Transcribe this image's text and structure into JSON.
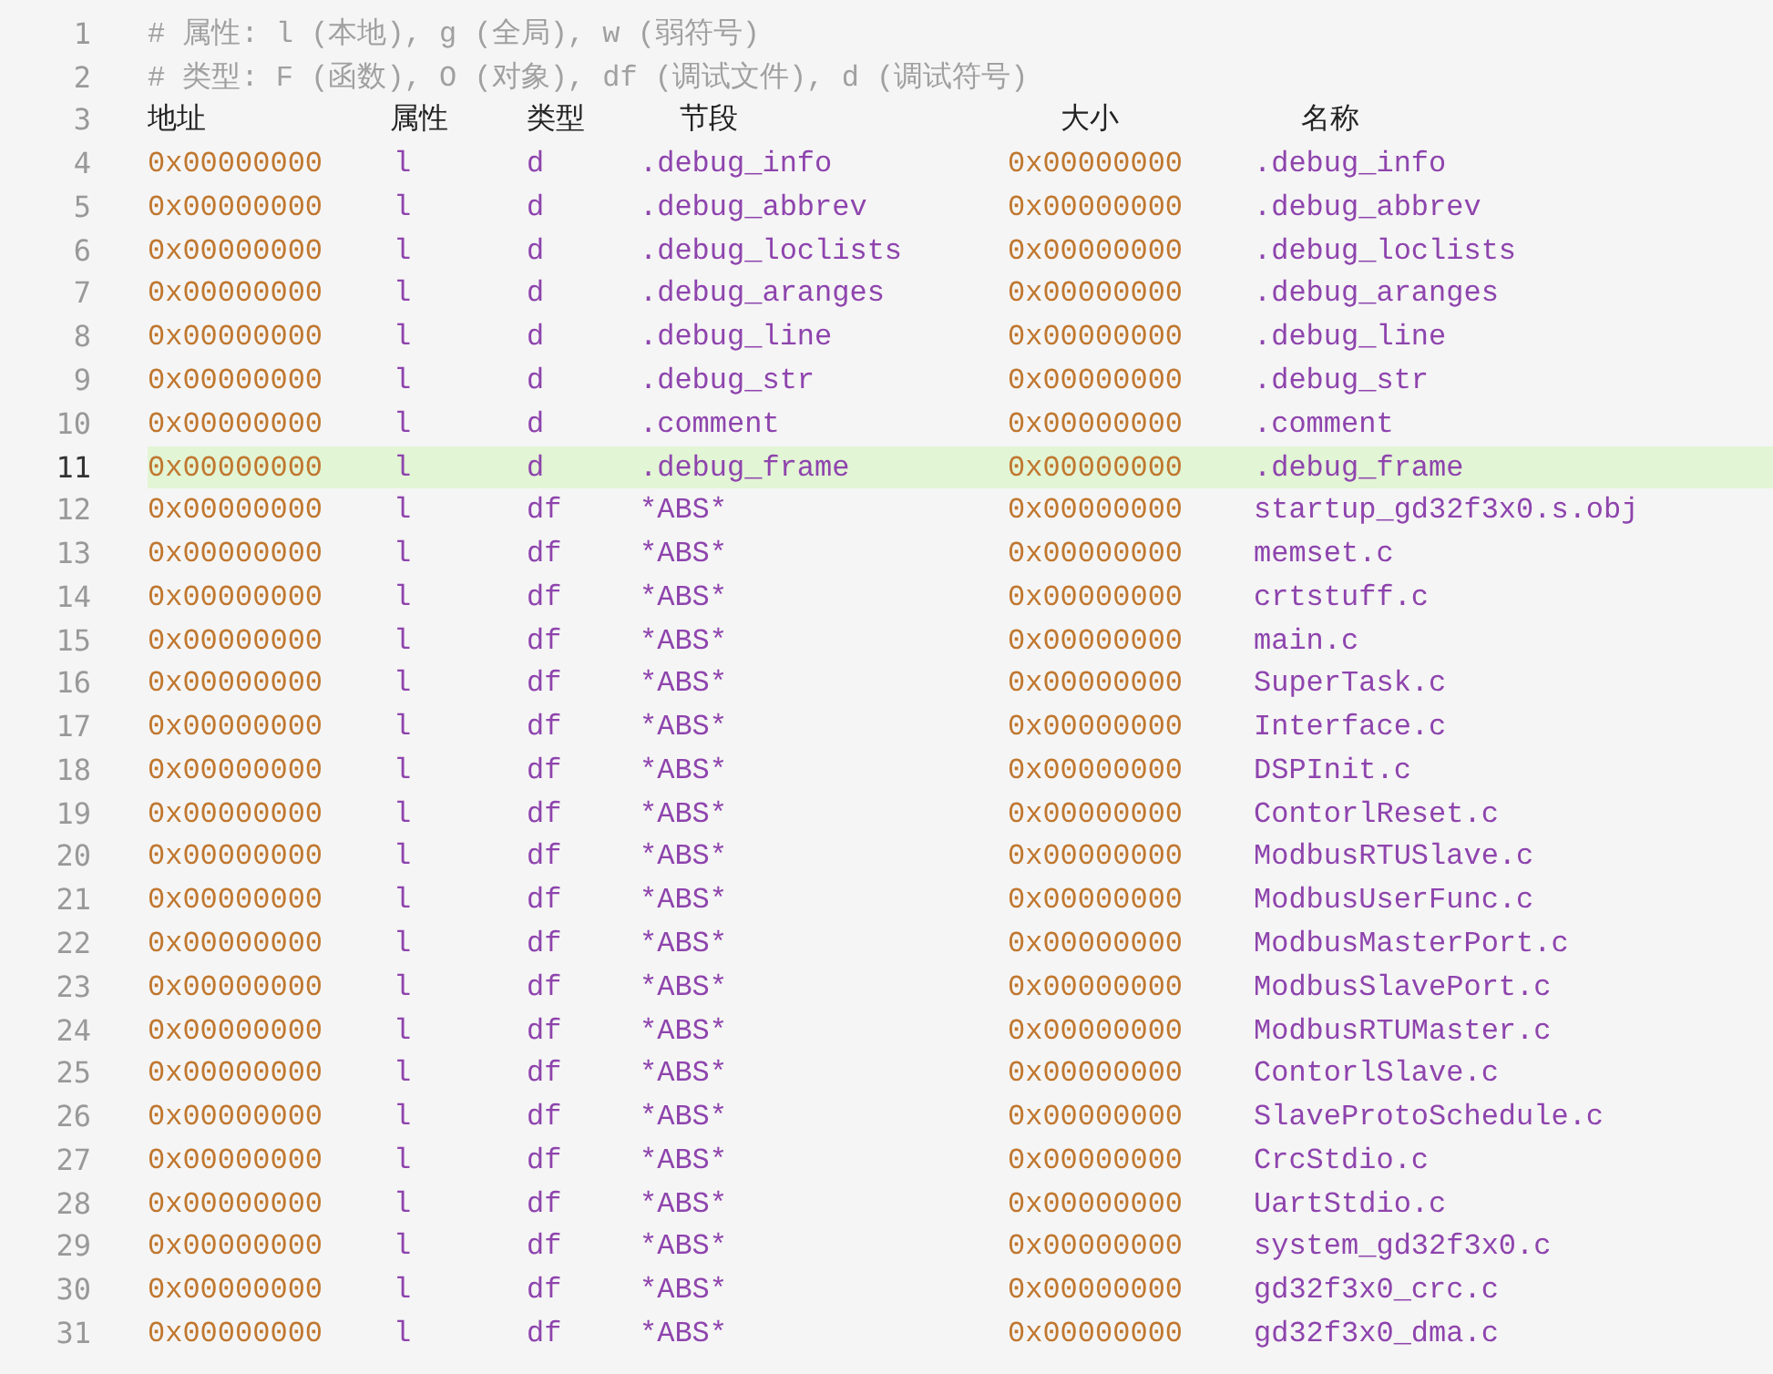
{
  "editor": {
    "lines": [
      {
        "kind": "comment",
        "number": "1",
        "text": "# 属性: l (本地), g (全局), w (弱符号)",
        "selected": false
      },
      {
        "kind": "comment",
        "number": "2",
        "text": "# 类型: F (函数), O (对象), df (调试文件), d (调试符号)",
        "selected": false
      },
      {
        "kind": "header",
        "number": "3",
        "cells": [
          "地址",
          "属性",
          "类型",
          "节段",
          "大小",
          "名称"
        ],
        "selected": false
      },
      {
        "kind": "symbol",
        "number": "4",
        "cells": [
          "0x00000000",
          "l",
          "d",
          ".debug_info",
          "0x00000000",
          ".debug_info"
        ],
        "selected": false
      },
      {
        "kind": "symbol",
        "number": "5",
        "cells": [
          "0x00000000",
          "l",
          "d",
          ".debug_abbrev",
          "0x00000000",
          ".debug_abbrev"
        ],
        "selected": false
      },
      {
        "kind": "symbol",
        "number": "6",
        "cells": [
          "0x00000000",
          "l",
          "d",
          ".debug_loclists",
          "0x00000000",
          ".debug_loclists"
        ],
        "selected": false
      },
      {
        "kind": "symbol",
        "number": "7",
        "cells": [
          "0x00000000",
          "l",
          "d",
          ".debug_aranges",
          "0x00000000",
          ".debug_aranges"
        ],
        "selected": false
      },
      {
        "kind": "symbol",
        "number": "8",
        "cells": [
          "0x00000000",
          "l",
          "d",
          ".debug_line",
          "0x00000000",
          ".debug_line"
        ],
        "selected": false
      },
      {
        "kind": "symbol",
        "number": "9",
        "cells": [
          "0x00000000",
          "l",
          "d",
          ".debug_str",
          "0x00000000",
          ".debug_str"
        ],
        "selected": false
      },
      {
        "kind": "symbol",
        "number": "10",
        "cells": [
          "0x00000000",
          "l",
          "d",
          ".comment",
          "0x00000000",
          ".comment"
        ],
        "selected": false
      },
      {
        "kind": "symbol",
        "number": "11",
        "cells": [
          "0x00000000",
          "l",
          "d",
          ".debug_frame",
          "0x00000000",
          ".debug_frame"
        ],
        "selected": true
      },
      {
        "kind": "symbol",
        "number": "12",
        "cells": [
          "0x00000000",
          "l",
          "df",
          "*ABS*",
          "0x00000000",
          "startup_gd32f3x0.s.obj"
        ],
        "selected": false
      },
      {
        "kind": "symbol",
        "number": "13",
        "cells": [
          "0x00000000",
          "l",
          "df",
          "*ABS*",
          "0x00000000",
          "memset.c"
        ],
        "selected": false
      },
      {
        "kind": "symbol",
        "number": "14",
        "cells": [
          "0x00000000",
          "l",
          "df",
          "*ABS*",
          "0x00000000",
          "crtstuff.c"
        ],
        "selected": false
      },
      {
        "kind": "symbol",
        "number": "15",
        "cells": [
          "0x00000000",
          "l",
          "df",
          "*ABS*",
          "0x00000000",
          "main.c"
        ],
        "selected": false
      },
      {
        "kind": "symbol",
        "number": "16",
        "cells": [
          "0x00000000",
          "l",
          "df",
          "*ABS*",
          "0x00000000",
          "SuperTask.c"
        ],
        "selected": false
      },
      {
        "kind": "symbol",
        "number": "17",
        "cells": [
          "0x00000000",
          "l",
          "df",
          "*ABS*",
          "0x00000000",
          "Interface.c"
        ],
        "selected": false
      },
      {
        "kind": "symbol",
        "number": "18",
        "cells": [
          "0x00000000",
          "l",
          "df",
          "*ABS*",
          "0x00000000",
          "DSPInit.c"
        ],
        "selected": false
      },
      {
        "kind": "symbol",
        "number": "19",
        "cells": [
          "0x00000000",
          "l",
          "df",
          "*ABS*",
          "0x00000000",
          "ContorlReset.c"
        ],
        "selected": false
      },
      {
        "kind": "symbol",
        "number": "20",
        "cells": [
          "0x00000000",
          "l",
          "df",
          "*ABS*",
          "0x00000000",
          "ModbusRTUSlave.c"
        ],
        "selected": false
      },
      {
        "kind": "symbol",
        "number": "21",
        "cells": [
          "0x00000000",
          "l",
          "df",
          "*ABS*",
          "0x00000000",
          "ModbusUserFunc.c"
        ],
        "selected": false
      },
      {
        "kind": "symbol",
        "number": "22",
        "cells": [
          "0x00000000",
          "l",
          "df",
          "*ABS*",
          "0x00000000",
          "ModbusMasterPort.c"
        ],
        "selected": false
      },
      {
        "kind": "symbol",
        "number": "23",
        "cells": [
          "0x00000000",
          "l",
          "df",
          "*ABS*",
          "0x00000000",
          "ModbusSlavePort.c"
        ],
        "selected": false
      },
      {
        "kind": "symbol",
        "number": "24",
        "cells": [
          "0x00000000",
          "l",
          "df",
          "*ABS*",
          "0x00000000",
          "ModbusRTUMaster.c"
        ],
        "selected": false
      },
      {
        "kind": "symbol",
        "number": "25",
        "cells": [
          "0x00000000",
          "l",
          "df",
          "*ABS*",
          "0x00000000",
          "ContorlSlave.c"
        ],
        "selected": false
      },
      {
        "kind": "symbol",
        "number": "26",
        "cells": [
          "0x00000000",
          "l",
          "df",
          "*ABS*",
          "0x00000000",
          "SlaveProtoSchedule.c"
        ],
        "selected": false
      },
      {
        "kind": "symbol",
        "number": "27",
        "cells": [
          "0x00000000",
          "l",
          "df",
          "*ABS*",
          "0x00000000",
          "CrcStdio.c"
        ],
        "selected": false
      },
      {
        "kind": "symbol",
        "number": "28",
        "cells": [
          "0x00000000",
          "l",
          "df",
          "*ABS*",
          "0x00000000",
          "UartStdio.c"
        ],
        "selected": false
      },
      {
        "kind": "symbol",
        "number": "29",
        "cells": [
          "0x00000000",
          "l",
          "df",
          "*ABS*",
          "0x00000000",
          "system_gd32f3x0.c"
        ],
        "selected": false
      },
      {
        "kind": "symbol",
        "number": "30",
        "cells": [
          "0x00000000",
          "l",
          "df",
          "*ABS*",
          "0x00000000",
          "gd32f3x0_crc.c"
        ],
        "selected": false
      },
      {
        "kind": "symbol",
        "number": "31",
        "cells": [
          "0x00000000",
          "l",
          "df",
          "*ABS*",
          "0x00000000",
          "gd32f3x0_dma.c"
        ],
        "selected": false
      }
    ]
  }
}
